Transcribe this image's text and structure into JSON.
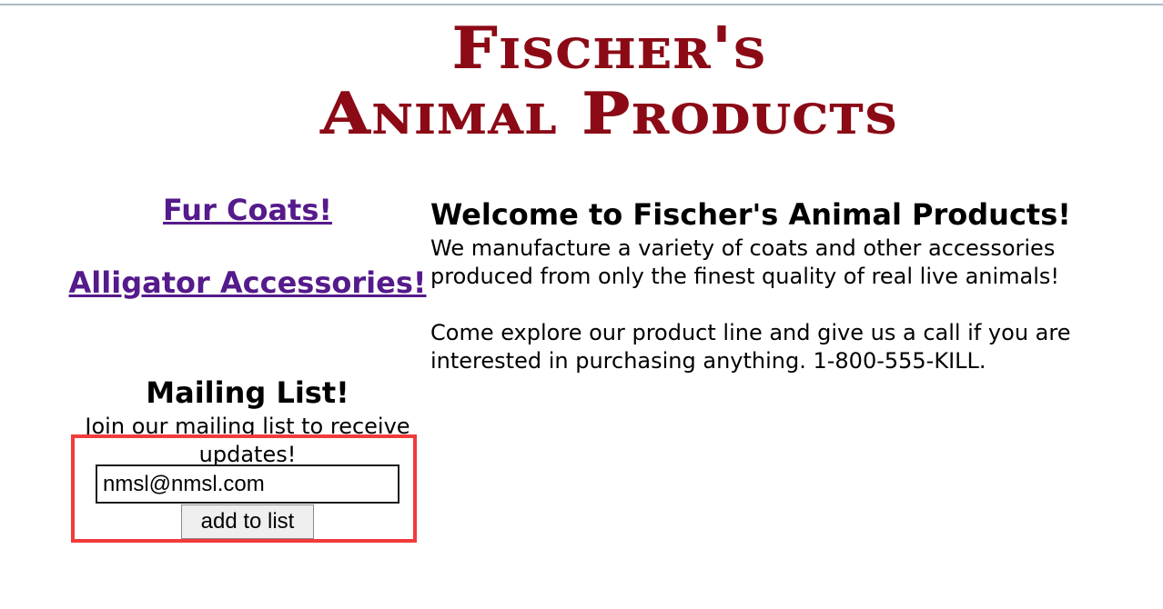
{
  "logo": {
    "line1": "Fischer's",
    "line2": "Animal Products",
    "color": "#8b0a16"
  },
  "nav": {
    "fur_coats": "Fur Coats!",
    "alligator_accessories": "Alligator Accessories!",
    "link_color": "#551a8b"
  },
  "mailing": {
    "title": "Mailing List!",
    "description": "Join our mailing list to receive updates!",
    "email_value": "nmsl@nmsl.com",
    "button_label": "add to list",
    "highlight_color": "#f23b3b"
  },
  "main": {
    "heading": "Welcome to Fischer's Animal Products!",
    "paragraph1": "We manufacture a variety of coats and other accessories produced from only the finest quality of real live animals!",
    "paragraph2": "Come explore our product line and give us a call if you are interested in purchasing anything. 1-800-555-KILL."
  }
}
